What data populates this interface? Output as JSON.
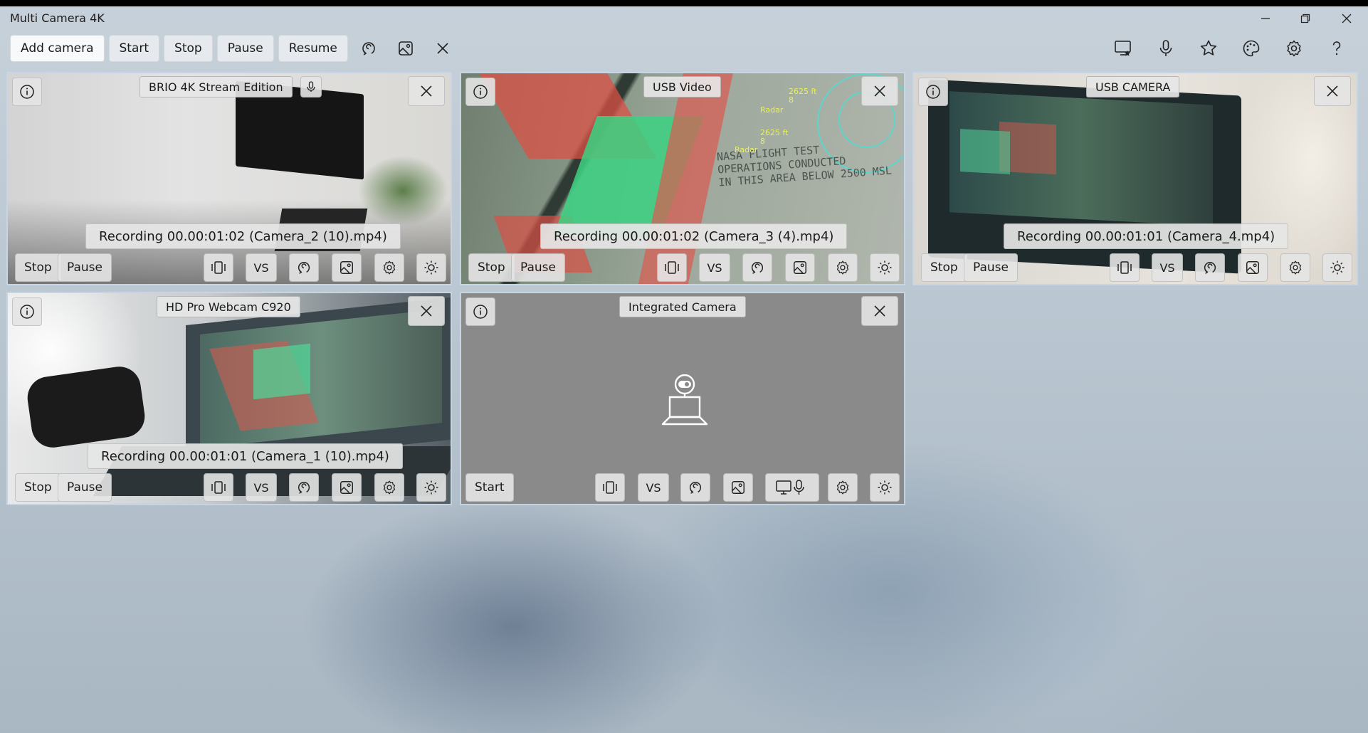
{
  "window": {
    "title": "Multi Camera 4K",
    "controls": [
      "minimize",
      "restore",
      "close"
    ]
  },
  "toolbar": {
    "add_camera": "Add camera",
    "start": "Start",
    "stop": "Stop",
    "pause": "Pause",
    "resume": "Resume",
    "left_icons": [
      "rotate-icon",
      "image-icon",
      "close-icon"
    ],
    "right_icons": [
      "screen-capture-icon",
      "microphone-icon",
      "star-icon",
      "palette-icon",
      "settings-icon",
      "help-icon"
    ]
  },
  "cameras": [
    {
      "name": "BRIO 4K Stream Edition",
      "status": "Recording 00.00:01:02 (Camera_2 (10).mp4)",
      "buttons": {
        "stop": "Stop",
        "pause": "Pause"
      },
      "vs": "VS",
      "has_mic": true
    },
    {
      "name": "USB Video",
      "status": "Recording 00.00:01:02 (Camera_3 (4).mp4)",
      "buttons": {
        "stop": "Stop",
        "pause": "Pause"
      },
      "vs": "VS",
      "overlay_text": [
        "2625 ft",
        "8",
        "Radar",
        "2625 ft",
        "8",
        "Radar",
        "NASA FLIGHT TEST",
        "OPERATIONS CONDUCTED",
        "IN THIS AREA BELOW 2500 MSL"
      ]
    },
    {
      "name": "USB CAMERA",
      "status": "Recording 00.00:01:01 (Camera_4.mp4)",
      "buttons": {
        "stop": "Stop",
        "pause": "Pause"
      },
      "vs": "VS"
    },
    {
      "name": "HD Pro Webcam C920",
      "status": "Recording 00.00:01:01 (Camera_1 (10).mp4)",
      "buttons": {
        "stop": "Stop",
        "pause": "Pause"
      },
      "vs": "VS"
    },
    {
      "name": "Integrated Camera",
      "status": "",
      "buttons": {
        "start": "Start"
      },
      "vs": "VS"
    }
  ],
  "colors": {
    "background": "#b6c3ce",
    "overlay_button": "#e4e4e4",
    "idle_feed": "#8a8a8a"
  }
}
